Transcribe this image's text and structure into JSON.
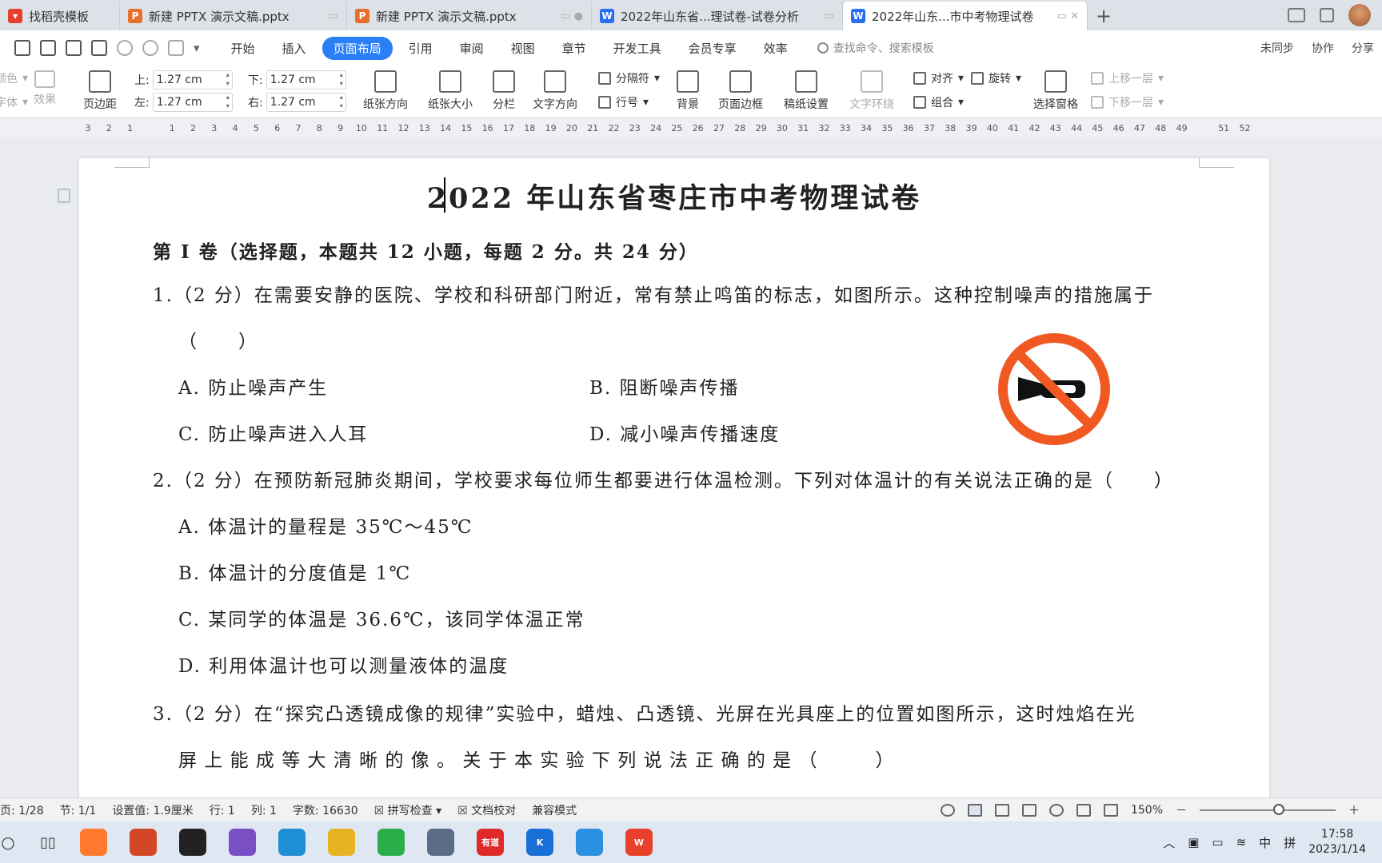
{
  "tabs": [
    {
      "label": "找稻壳模板",
      "color": "#e8402a"
    },
    {
      "label": "新建 PPTX 演示文稿.pptx",
      "color": "#e8702a"
    },
    {
      "label": "新建 PPTX 演示文稿.pptx",
      "color": "#e8702a"
    },
    {
      "label": "2022年山东省...理试卷-试卷分析",
      "color": "#2a6ff0"
    },
    {
      "label": "2022年山东...市中考物理试卷",
      "color": "#2a6ff0"
    }
  ],
  "menu": [
    "开始",
    "插入",
    "页面布局",
    "引用",
    "审阅",
    "视图",
    "章节",
    "开发工具",
    "会员专享",
    "效率"
  ],
  "search_placeholder": "查找命令、搜索模板",
  "menu_right": {
    "sync": "未同步",
    "collab": "协作",
    "share": "分享"
  },
  "ribbon": {
    "color": "颜色",
    "font": "字体",
    "effect": "效果",
    "margin": "页边距",
    "top_label": "上:",
    "top_value": "1.27 cm",
    "bottom_label": "下:",
    "bottom_value": "1.27 cm",
    "left_label": "左:",
    "left_value": "1.27 cm",
    "right_label": "右:",
    "right_value": "1.27 cm",
    "orientation": "纸张方向",
    "size": "纸张大小",
    "columns": "分栏",
    "text_dir": "文字方向",
    "separator": "分隔符",
    "line_no": "行号",
    "background": "背景",
    "page_border": "页面边框",
    "manuscript": "稿纸设置",
    "wrap": "文字环绕",
    "align": "对齐",
    "rotate": "旋转",
    "group": "组合",
    "select_pane": "选择窗格",
    "bring_up": "上移一层",
    "send_down": "下移一层"
  },
  "ruler_ticks": [
    "3",
    "2",
    "1",
    "1",
    "2",
    "3",
    "4",
    "5",
    "6",
    "7",
    "8",
    "9",
    "10",
    "11",
    "12",
    "13",
    "14",
    "15",
    "16",
    "17",
    "18",
    "19",
    "20",
    "21",
    "22",
    "23",
    "24",
    "25",
    "26",
    "27",
    "28",
    "29",
    "30",
    "31",
    "32",
    "33",
    "34",
    "35",
    "36",
    "37",
    "38",
    "39",
    "40",
    "41",
    "42",
    "43",
    "44",
    "45",
    "46",
    "47",
    "48",
    "49",
    "51",
    "52"
  ],
  "doc": {
    "title": "2022 年山东省枣庄市中考物理试卷",
    "section": "第 I 卷（选择题，本题共 12 小题，每题 2 分。共 24 分）",
    "q1": "1.（2 分）在需要安静的医院、学校和科研部门附近，常有禁止鸣笛的标志，如图所示。这种控制噪声的措施属于",
    "q1_blank": "（　　）",
    "q1_a": "A. 防止噪声产生",
    "q1_b": "B. 阻断噪声传播",
    "q1_c": "C. 防止噪声进入人耳",
    "q1_d": "D. 减小噪声传播速度",
    "q2": "2.（2 分）在预防新冠肺炎期间，学校要求每位师生都要进行体温检测。下列对体温计的有关说法正确的是（　　）",
    "q2_a": "A. 体温计的量程是 35℃～45℃",
    "q2_b": "B. 体温计的分度值是 1℃",
    "q2_c": "C. 某同学的体温是 36.6℃，该同学体温正常",
    "q2_d": "D. 利用体温计也可以测量液体的温度",
    "q3": "3.（2 分）在“探究凸透镜成像的规律”实验中，蜡烛、凸透镜、光屏在光具座上的位置如图所示，这时烛焰在光",
    "q3_cont": "屏 上 能 成 等 大 清 晰 的 像 。 关 于 本 实 验 下 列 说 法 正 确 的 是 （　　　）"
  },
  "status": {
    "page": "页: 1/28",
    "section": "节: 1/1",
    "setting": "设置值: 1.9厘米",
    "row": "行: 1",
    "col": "列: 1",
    "words": "字数: 16630",
    "spell": "拼写检查",
    "proof": "文档校对",
    "compat": "兼容模式",
    "zoom": "150%"
  },
  "taskbar_apps": [
    {
      "label": "",
      "color": "#ff7a2e"
    },
    {
      "label": "",
      "color": "#d24726"
    },
    {
      "label": "",
      "color": "#222222"
    },
    {
      "label": "",
      "color": "#7a4fc4"
    },
    {
      "label": "",
      "color": "#1e8fd6"
    },
    {
      "label": "",
      "color": "#e6b422"
    },
    {
      "label": "",
      "color": "#2aae4a"
    },
    {
      "label": "",
      "color": "#5a6c88"
    },
    {
      "label": "有道",
      "color": "#e02a2a"
    },
    {
      "label": "K",
      "color": "#1a6fd6"
    },
    {
      "label": "",
      "color": "#2a90e0"
    },
    {
      "label": "W",
      "color": "#e8402a"
    }
  ],
  "tray": {
    "ime": "中",
    "ime2": "拼",
    "time": "17:58",
    "date": "2023/1/14"
  }
}
